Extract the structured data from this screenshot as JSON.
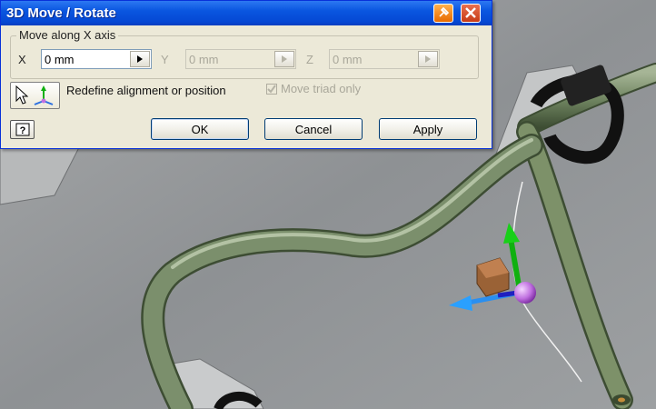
{
  "window": {
    "title": "3D Move / Rotate"
  },
  "group": {
    "label": "Move along X axis",
    "x": {
      "label": "X",
      "value": "0 mm"
    },
    "y": {
      "label": "Y",
      "value": "0 mm"
    },
    "z": {
      "label": "Z",
      "value": "0 mm"
    }
  },
  "redefine_label": "Redefine alignment or position",
  "move_triad_label": "Move triad only",
  "move_triad_checked": true,
  "buttons": {
    "ok": "OK",
    "cancel": "Cancel",
    "apply": "Apply"
  },
  "colors": {
    "titlebar": "#0a56e0",
    "dialog_bg": "#ece9d8",
    "pipe": "#7b8f6c",
    "triad_x": "#2a8ff0",
    "triad_y": "#10b010",
    "triad_z": "#2020c0",
    "center_ball": "#c070e0",
    "clamp": "#151515"
  }
}
